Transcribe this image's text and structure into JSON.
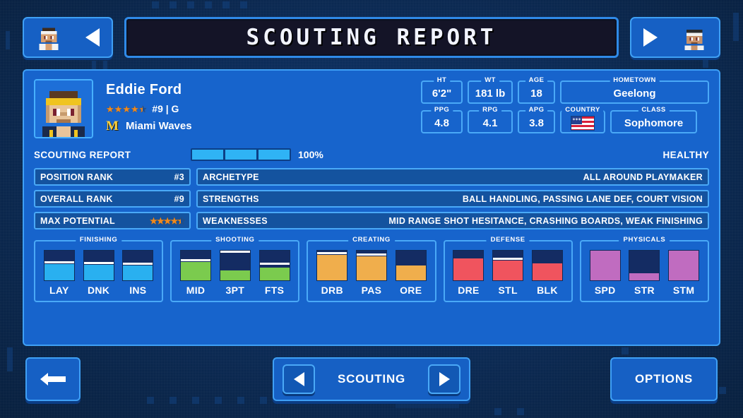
{
  "header": {
    "title": "SCOUTING REPORT",
    "prev_button": {
      "name": "previous-player",
      "icon": "triangle-left-icon"
    },
    "next_button": {
      "name": "next-player",
      "icon": "triangle-right-icon"
    }
  },
  "player": {
    "name": "Eddie Ford",
    "stars": 4.5,
    "jersey": "#9 | G",
    "team_logo_letter": "M",
    "team": "Miami Waves",
    "attributes": [
      {
        "caption": "HT",
        "value": "6'2\""
      },
      {
        "caption": "WT",
        "value": "181 lb"
      },
      {
        "caption": "AGE",
        "value": "18"
      },
      {
        "caption": "HOMETOWN",
        "value": "Geelong"
      },
      {
        "caption": "PPG",
        "value": "4.8"
      },
      {
        "caption": "RPG",
        "value": "4.1"
      },
      {
        "caption": "APG",
        "value": "3.8"
      },
      {
        "caption": "COUNTRY",
        "value": "",
        "icon": "usa-flag-icon"
      },
      {
        "caption": "CLASS",
        "value": "Sophomore"
      }
    ]
  },
  "report": {
    "section_label": "SCOUTING REPORT",
    "progress_percent": "100%",
    "progress_segments": [
      true,
      true,
      true
    ],
    "health_status": "HEALTHY",
    "left_rows": [
      {
        "key": "POSITION RANK",
        "value": "#3"
      },
      {
        "key": "OVERALL RANK",
        "value": "#9"
      },
      {
        "key": "MAX POTENTIAL",
        "value": "",
        "stars": 4.5
      }
    ],
    "right_rows": [
      {
        "key": "ARCHETYPE",
        "value": "ALL AROUND PLAYMAKER"
      },
      {
        "key": "STRENGTHS",
        "value": "BALL HANDLING, PASSING LANE DEF, COURT VISION"
      },
      {
        "key": "WEAKNESSES",
        "value": "MID RANGE SHOT HESITANCE, CRASHING BOARDS, WEAK FINISHING"
      }
    ]
  },
  "attribute_groups": [
    {
      "caption": "FINISHING",
      "color": "#29b0f0",
      "items": [
        {
          "label": "LAY",
          "fill": 55,
          "tick": 57
        },
        {
          "label": "DNK",
          "fill": 52,
          "tick": 54
        },
        {
          "label": "INS",
          "fill": 50,
          "tick": 52
        }
      ]
    },
    {
      "caption": "SHOOTING",
      "color": "#7bcb4e",
      "items": [
        {
          "label": "MID",
          "fill": 62,
          "tick": 64
        },
        {
          "label": "3PT",
          "fill": 34,
          "tick": 93
        },
        {
          "label": "FTS",
          "fill": 43,
          "tick": 52
        }
      ]
    },
    {
      "caption": "CREATING",
      "color": "#f0ae4c",
      "items": [
        {
          "label": "DRB",
          "fill": 86,
          "tick": 88
        },
        {
          "label": "PAS",
          "fill": 82,
          "tick": 84
        },
        {
          "label": "ORE",
          "fill": 50,
          "tick": 0
        }
      ]
    },
    {
      "caption": "DEFENSE",
      "color": "#f0545e",
      "items": [
        {
          "label": "DRE",
          "fill": 75,
          "tick": 0
        },
        {
          "label": "STL",
          "fill": 66,
          "tick": 70
        },
        {
          "label": "BLK",
          "fill": 57,
          "tick": 0
        }
      ]
    },
    {
      "caption": "PHYSICALS",
      "color": "#c06cc0",
      "items": [
        {
          "label": "SPD",
          "fill": 100,
          "tick": 0
        },
        {
          "label": "STR",
          "fill": 25,
          "tick": 0
        },
        {
          "label": "STM",
          "fill": 100,
          "tick": 0
        }
      ]
    }
  ],
  "footer": {
    "back_label": "",
    "back_icon": "arrow-left-icon",
    "center_label": "SCOUTING",
    "center_prev_icon": "triangle-left-icon",
    "center_next_icon": "triangle-right-icon",
    "options_label": "OPTIONS"
  },
  "colors": {
    "panel_bg": "#1764cc",
    "panel_border": "#3fa0f5",
    "title_bg": "#141427",
    "row_bg": "#14539f",
    "meter_bg": "#142c63",
    "star": "#f08a1e"
  }
}
